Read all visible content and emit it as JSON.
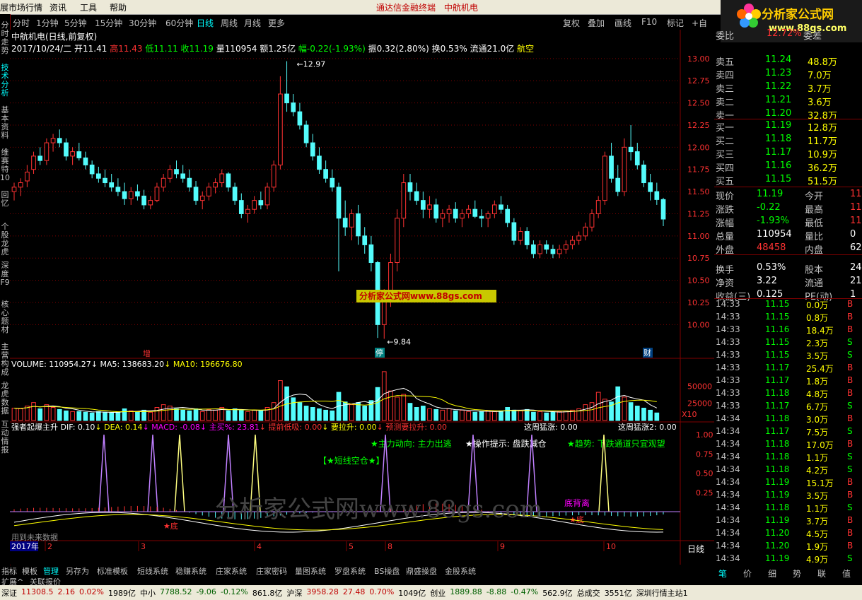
{
  "colors": {
    "up": "#ff3232",
    "down": "#54fcfc",
    "white": "#ffffff",
    "yellow": "#ffff00",
    "green": "#00ff00",
    "magenta": "#ff00ff",
    "grid": "#800000"
  },
  "menu": {
    "items": [
      "展市场行情",
      "资讯",
      "工具",
      "帮助"
    ],
    "center_items": [
      "通达信金融终端",
      "中航机电"
    ]
  },
  "logo": {
    "title": "分析家公式网",
    "url": "www.88gs.com"
  },
  "left_tabs": [
    "分时走势",
    "技术分析",
    "基本资料",
    "维赛特10",
    "回忆",
    "个股龙虎",
    "深度F9",
    "核心题材",
    "主营构成",
    "龙虎数据",
    "互动情报"
  ],
  "period_buttons": [
    "分时",
    "1分钟",
    "5分钟",
    "15分钟",
    "30分钟",
    "60分钟",
    "日线",
    "周线",
    "月线",
    "更多"
  ],
  "period_selected": "日线",
  "right_buttons": [
    "复权",
    "叠加",
    "画线",
    "F10",
    "标记",
    "+自选"
  ],
  "stock": {
    "title": "中航机电(日线,前复权)",
    "info": [
      [
        "2017/10/24/二",
        "white"
      ],
      [
        "开11.41",
        "white"
      ],
      [
        "高11.43",
        "red"
      ],
      [
        "低11.11",
        "green"
      ],
      [
        "收11.19",
        "green"
      ],
      [
        "量110954",
        "white"
      ],
      [
        "额1.25亿",
        "white"
      ],
      [
        "幅-0.22(-1.93%)",
        "green"
      ],
      [
        "振0.32(2.80%)",
        "white"
      ],
      [
        "换0.53%",
        "white"
      ],
      [
        "流通21.0亿",
        "white"
      ],
      [
        "航空",
        "yellow"
      ]
    ]
  },
  "main_axis": [
    "13.00",
    "12.75",
    "12.50",
    "12.25",
    "12.00",
    "11.75",
    "11.50",
    "11.25",
    "11.00",
    "10.75",
    "10.50",
    "10.25",
    "10.00"
  ],
  "high_label": "12.97",
  "low_label": "9.84",
  "markers": [
    "增",
    "停",
    "财"
  ],
  "watermark_box": "分析家公式网www.88gs.com",
  "volume": {
    "info": [
      [
        "VOLUME: 110954.27",
        "white"
      ],
      [
        "MA5: 138683.20",
        "white"
      ],
      [
        "MA10: 196676.80",
        "yellow"
      ]
    ],
    "axis": [
      "50000",
      "25000"
    ],
    "unit": "X10"
  },
  "indicator": {
    "name": "强者起爆主升",
    "info": [
      [
        "DIF: 0.10",
        "white"
      ],
      [
        "DEA: 0.14",
        "yellow"
      ],
      [
        "MACD: -0.08",
        "magenta"
      ],
      [
        "主买%: 23.81",
        "magenta"
      ],
      [
        "提前低吸: 0.00",
        "red"
      ],
      [
        "要拉升: 0.00",
        "yellow"
      ],
      [
        "预测要拉升: 0.00",
        "red"
      ]
    ],
    "weekly": [
      "这周猛涨: 0.00",
      "这周猛涨2: 0.00"
    ],
    "axis": [
      "1.00",
      "0.75",
      "0.50",
      "0.25"
    ],
    "text1": "★主力动向: 主力出逃",
    "text2": "★操作提示: 盘跌减仓",
    "text3": "★趋势: 下跌通道只宜观望",
    "text4": "【★短线空仓★】",
    "text5": "底背离",
    "text6": "★底",
    "text7": "★底",
    "text8": "用到未来数据"
  },
  "chart_watermark": "分析家公式网www.88gs.com",
  "dates": {
    "year": "2017年",
    "months": [
      "2",
      "3",
      "4",
      "5",
      "8",
      "9",
      "10"
    ],
    "period_label": "日线"
  },
  "bottom_tabs": [
    "指标",
    "模板",
    "管理",
    "另存为",
    "标准模板",
    "短线系统",
    "稳赚系统",
    "庄家系统",
    "庄家密码",
    "量图系统",
    "罗盘系统",
    "BS操盘",
    "鼎盛操盘",
    "金股系统"
  ],
  "bottom_tab_selected": "管理",
  "bottom_tabs2": [
    "扩展^",
    "关联报价"
  ],
  "quote": {
    "header": [
      "委比",
      "12.72%",
      "委差"
    ],
    "asks": [
      [
        "卖五",
        "11.24",
        "48.8万"
      ],
      [
        "卖四",
        "11.23",
        "7.0万"
      ],
      [
        "卖三",
        "11.22",
        "3.7万"
      ],
      [
        "卖二",
        "11.21",
        "3.6万"
      ],
      [
        "卖一",
        "11.20",
        "32.8万"
      ]
    ],
    "bids": [
      [
        "买一",
        "11.19",
        "12.8万"
      ],
      [
        "买二",
        "11.18",
        "11.7万"
      ],
      [
        "买三",
        "11.17",
        "10.9万"
      ],
      [
        "买四",
        "11.16",
        "36.2万"
      ],
      [
        "买五",
        "11.15",
        "51.5万"
      ]
    ],
    "stats": [
      [
        "现价",
        "11.19",
        "今开",
        "11"
      ],
      [
        "涨跌",
        "-0.22",
        "最高",
        "11"
      ],
      [
        "涨幅",
        "-1.93%",
        "最低",
        "11"
      ],
      [
        "总量",
        "110954",
        "量比",
        "0"
      ],
      [
        "外盘",
        "48458",
        "内盘",
        "62"
      ],
      [
        "换手",
        "0.53%",
        "股本",
        "24."
      ],
      [
        "净资",
        "3.22",
        "流通",
        "21."
      ],
      [
        "收益(三)",
        "0.125",
        "PE(动)",
        "1"
      ]
    ]
  },
  "ticks": [
    [
      "14:33",
      "11.15",
      "0.0万",
      "B"
    ],
    [
      "14:33",
      "11.15",
      "0.8万",
      "B"
    ],
    [
      "14:33",
      "11.16",
      "18.4万",
      "B"
    ],
    [
      "14:33",
      "11.15",
      "2.3万",
      "S"
    ],
    [
      "14:33",
      "11.15",
      "3.5万",
      "S"
    ],
    [
      "14:33",
      "11.17",
      "25.4万",
      "B"
    ],
    [
      "14:33",
      "11.17",
      "1.8万",
      "B"
    ],
    [
      "14:33",
      "11.18",
      "4.8万",
      "B"
    ],
    [
      "14:33",
      "11.17",
      "6.7万",
      "S"
    ],
    [
      "14:34",
      "11.18",
      "3.0万",
      "B"
    ],
    [
      "14:34",
      "11.17",
      "7.5万",
      "S"
    ],
    [
      "14:34",
      "11.18",
      "17.0万",
      "B"
    ],
    [
      "14:34",
      "11.18",
      "1.1万",
      "S"
    ],
    [
      "14:34",
      "11.18",
      "4.2万",
      "S"
    ],
    [
      "14:34",
      "11.19",
      "15.1万",
      "B"
    ],
    [
      "14:34",
      "11.19",
      "3.5万",
      "B"
    ],
    [
      "14:34",
      "11.18",
      "1.1万",
      "S"
    ],
    [
      "14:34",
      "11.19",
      "3.7万",
      "B"
    ],
    [
      "14:34",
      "11.20",
      "4.5万",
      "B"
    ],
    [
      "14:34",
      "11.20",
      "1.9万",
      "B"
    ],
    [
      "14:34",
      "11.19",
      "4.9万",
      "S"
    ]
  ],
  "right_footer": [
    "笔",
    "价",
    "细",
    "势",
    "联",
    "值"
  ],
  "status": {
    "items": [
      [
        "深证",
        "#000"
      ],
      [
        "11308.5",
        "#c00000"
      ],
      [
        "2.16",
        "#c00000"
      ],
      [
        "0.02%",
        "#c00000"
      ],
      [
        "1989亿",
        "#000"
      ],
      [
        "中小",
        "#000"
      ],
      [
        "7788.52",
        "#006000"
      ],
      [
        "-9.06",
        "#006000"
      ],
      [
        "-0.12%",
        "#006000"
      ],
      [
        "861.8亿",
        "#000"
      ],
      [
        "沪深",
        "#000"
      ],
      [
        "3958.28",
        "#c00000"
      ],
      [
        "27.48",
        "#c00000"
      ],
      [
        "0.70%",
        "#c00000"
      ],
      [
        "1049亿",
        "#000"
      ],
      [
        "创业",
        "#000"
      ],
      [
        "1889.88",
        "#006000"
      ],
      [
        "-8.88",
        "#006000"
      ],
      [
        "-0.47%",
        "#006000"
      ],
      [
        "562.9亿",
        "#000"
      ],
      [
        "总成交",
        "#000"
      ],
      [
        "3551亿",
        "#000"
      ],
      [
        "深圳行情主站1",
        "#000"
      ]
    ]
  },
  "chart_data": {
    "type": "candlestick",
    "ylim": [
      9.7,
      13.15
    ],
    "candles": [
      [
        11.5,
        11.6,
        11.4,
        11.55
      ],
      [
        11.55,
        11.65,
        11.45,
        11.6
      ],
      [
        11.62,
        11.8,
        11.55,
        11.72
      ],
      [
        11.75,
        11.95,
        11.7,
        11.9
      ],
      [
        11.9,
        12.0,
        11.8,
        11.85
      ],
      [
        11.85,
        12.1,
        11.8,
        12.05
      ],
      [
        12.05,
        12.15,
        11.95,
        12.1
      ],
      [
        12.1,
        12.2,
        12.0,
        12.05
      ],
      [
        12.05,
        12.1,
        11.85,
        11.9
      ],
      [
        11.9,
        12.0,
        11.8,
        11.95
      ],
      [
        11.95,
        12.05,
        11.85,
        11.88
      ],
      [
        11.88,
        11.95,
        11.75,
        11.8
      ],
      [
        11.8,
        11.85,
        11.65,
        11.7
      ],
      [
        11.7,
        11.78,
        11.6,
        11.65
      ],
      [
        11.65,
        11.75,
        11.55,
        11.6
      ],
      [
        11.6,
        11.7,
        11.5,
        11.55
      ],
      [
        11.55,
        11.65,
        11.45,
        11.5
      ],
      [
        11.5,
        11.6,
        11.35,
        11.42
      ],
      [
        11.42,
        11.55,
        11.35,
        11.5
      ],
      [
        11.5,
        11.58,
        11.4,
        11.45
      ],
      [
        11.45,
        11.52,
        11.3,
        11.35
      ],
      [
        11.35,
        11.45,
        11.3,
        11.4
      ],
      [
        11.4,
        11.6,
        11.38,
        11.55
      ],
      [
        11.55,
        11.7,
        11.5,
        11.65
      ],
      [
        11.65,
        11.8,
        11.6,
        11.75
      ],
      [
        11.75,
        11.85,
        11.65,
        11.7
      ],
      [
        11.7,
        11.8,
        11.6,
        11.65
      ],
      [
        11.65,
        11.75,
        11.5,
        11.55
      ],
      [
        11.55,
        11.62,
        11.35,
        11.4
      ],
      [
        11.4,
        11.5,
        11.3,
        11.45
      ],
      [
        11.45,
        11.6,
        11.4,
        11.55
      ],
      [
        11.55,
        11.65,
        11.48,
        11.6
      ],
      [
        11.6,
        11.75,
        11.55,
        11.7
      ],
      [
        11.7,
        11.72,
        11.5,
        11.55
      ],
      [
        11.55,
        11.6,
        11.35,
        11.4
      ],
      [
        11.4,
        11.48,
        11.2,
        11.25
      ],
      [
        11.25,
        11.35,
        11.15,
        11.3
      ],
      [
        11.3,
        11.45,
        11.25,
        11.4
      ],
      [
        11.4,
        11.5,
        11.3,
        11.35
      ],
      [
        11.35,
        11.6,
        11.3,
        11.55
      ],
      [
        11.55,
        11.85,
        11.5,
        11.8
      ],
      [
        11.8,
        12.8,
        11.75,
        12.6
      ],
      [
        12.6,
        12.97,
        12.4,
        12.5
      ],
      [
        12.5,
        12.6,
        12.35,
        12.4
      ],
      [
        12.4,
        12.5,
        12.2,
        12.25
      ],
      [
        12.25,
        12.3,
        12.0,
        12.05
      ],
      [
        12.05,
        12.15,
        11.85,
        11.9
      ],
      [
        11.9,
        12.0,
        11.7,
        11.75
      ],
      [
        11.75,
        11.85,
        11.6,
        11.65
      ],
      [
        11.65,
        11.75,
        11.5,
        11.55
      ],
      [
        11.55,
        11.6,
        10.6,
        11.2
      ],
      [
        11.2,
        11.4,
        11.0,
        11.1
      ],
      [
        11.1,
        11.3,
        10.95,
        11.25
      ],
      [
        11.25,
        11.35,
        10.9,
        11.0
      ],
      [
        11.0,
        11.1,
        10.8,
        10.9
      ],
      [
        10.9,
        11.0,
        10.6,
        10.7
      ],
      [
        10.7,
        10.72,
        9.85,
        10.0
      ],
      [
        10.0,
        10.4,
        9.84,
        10.3
      ],
      [
        10.3,
        10.8,
        10.2,
        10.7
      ],
      [
        10.7,
        11.3,
        10.6,
        11.2
      ],
      [
        11.2,
        11.7,
        11.1,
        11.6
      ],
      [
        11.6,
        11.7,
        11.4,
        11.5
      ],
      [
        11.5,
        11.6,
        11.35,
        11.4
      ],
      [
        11.4,
        11.5,
        11.2,
        11.3
      ],
      [
        11.3,
        11.45,
        11.2,
        11.35
      ],
      [
        11.35,
        11.42,
        11.15,
        11.2
      ],
      [
        11.2,
        11.3,
        11.1,
        11.25
      ],
      [
        11.25,
        11.35,
        11.15,
        11.3
      ],
      [
        11.3,
        11.38,
        11.15,
        11.2
      ],
      [
        11.2,
        11.3,
        11.1,
        11.25
      ],
      [
        11.25,
        11.35,
        11.2,
        11.3
      ],
      [
        11.3,
        11.4,
        11.2,
        11.22
      ],
      [
        11.22,
        11.3,
        11.1,
        11.2
      ],
      [
        11.2,
        11.28,
        11.1,
        11.25
      ],
      [
        11.25,
        11.4,
        11.2,
        11.35
      ],
      [
        11.35,
        11.45,
        11.25,
        11.3
      ],
      [
        11.3,
        11.35,
        11.1,
        11.15
      ],
      [
        11.15,
        11.2,
        10.9,
        10.95
      ],
      [
        10.95,
        11.1,
        10.9,
        11.05
      ],
      [
        11.05,
        11.1,
        10.85,
        10.9
      ],
      [
        10.9,
        10.95,
        10.75,
        10.8
      ],
      [
        10.8,
        10.95,
        10.75,
        10.9
      ],
      [
        10.9,
        10.95,
        10.8,
        10.85
      ],
      [
        10.85,
        10.9,
        10.75,
        10.8
      ],
      [
        10.8,
        10.9,
        10.75,
        10.85
      ],
      [
        10.85,
        10.95,
        10.8,
        10.9
      ],
      [
        10.9,
        11.0,
        10.85,
        10.95
      ],
      [
        10.95,
        11.05,
        10.9,
        11.0
      ],
      [
        11.0,
        11.15,
        10.95,
        11.1
      ],
      [
        11.1,
        11.3,
        11.05,
        11.25
      ],
      [
        11.25,
        11.45,
        11.2,
        11.4
      ],
      [
        11.4,
        11.95,
        11.35,
        11.9
      ],
      [
        11.9,
        12.05,
        11.6,
        11.65
      ],
      [
        11.65,
        11.8,
        11.45,
        11.5
      ],
      [
        11.5,
        12.1,
        11.45,
        12.0
      ],
      [
        12.0,
        12.25,
        11.85,
        11.95
      ],
      [
        11.95,
        12.05,
        11.75,
        11.8
      ],
      [
        11.8,
        11.85,
        11.55,
        11.6
      ],
      [
        11.6,
        11.7,
        11.4,
        11.5
      ],
      [
        11.5,
        11.6,
        11.35,
        11.41
      ],
      [
        11.41,
        11.43,
        11.11,
        11.19
      ]
    ],
    "volume": [
      18000,
      17000,
      21000,
      26000,
      17000,
      23000,
      19000,
      16000,
      14000,
      13000,
      13000,
      12000,
      11000,
      13000,
      12000,
      11000,
      12000,
      17000,
      14000,
      13000,
      15000,
      12000,
      19000,
      23000,
      21000,
      17000,
      15000,
      14000,
      17000,
      13000,
      16000,
      15000,
      19000,
      14000,
      17000,
      15000,
      13000,
      15000,
      14000,
      19000,
      26000,
      58000,
      49000,
      33000,
      26000,
      21000,
      19000,
      17000,
      15000,
      14000,
      41000,
      27000,
      23000,
      26000,
      21000,
      29000,
      48000,
      71000,
      43000,
      34000,
      38000,
      25000,
      19000,
      21000,
      17000,
      16000,
      15000,
      17000,
      14000,
      15000,
      13000,
      12000,
      13000,
      14000,
      13000,
      14000,
      19000,
      15000,
      14000,
      16000,
      12000,
      13000,
      11000,
      12000,
      13000,
      14000,
      15000,
      17000,
      23000,
      26000,
      41000,
      31000,
      27000,
      49000,
      34000,
      26000,
      21000,
      18000,
      15000,
      11000
    ]
  }
}
